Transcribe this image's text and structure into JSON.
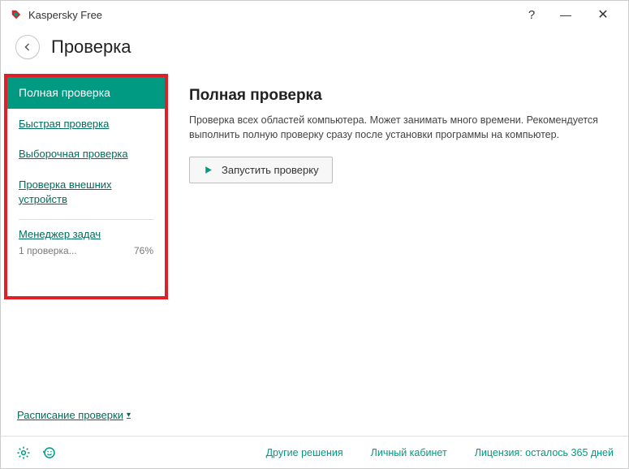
{
  "titlebar": {
    "app_name": "Kaspersky Free"
  },
  "header": {
    "page_title": "Проверка"
  },
  "sidebar": {
    "items": [
      {
        "label": "Полная проверка",
        "active": true
      },
      {
        "label": "Быстрая проверка"
      },
      {
        "label": "Выборочная проверка"
      },
      {
        "label": "Проверка внешних устройств"
      }
    ],
    "task_manager": {
      "link": "Менеджер задач",
      "status": "1 проверка...",
      "percent": "76%"
    },
    "schedule": "Расписание проверки"
  },
  "main": {
    "title": "Полная проверка",
    "desc": "Проверка всех областей компьютера. Может занимать много времени. Рекомендуется выполнить полную проверку сразу после установки программы на компьютер.",
    "run_label": "Запустить проверку"
  },
  "footer": {
    "links": [
      "Другие решения",
      "Личный кабинет",
      "Лицензия: осталось 365 дней"
    ]
  }
}
